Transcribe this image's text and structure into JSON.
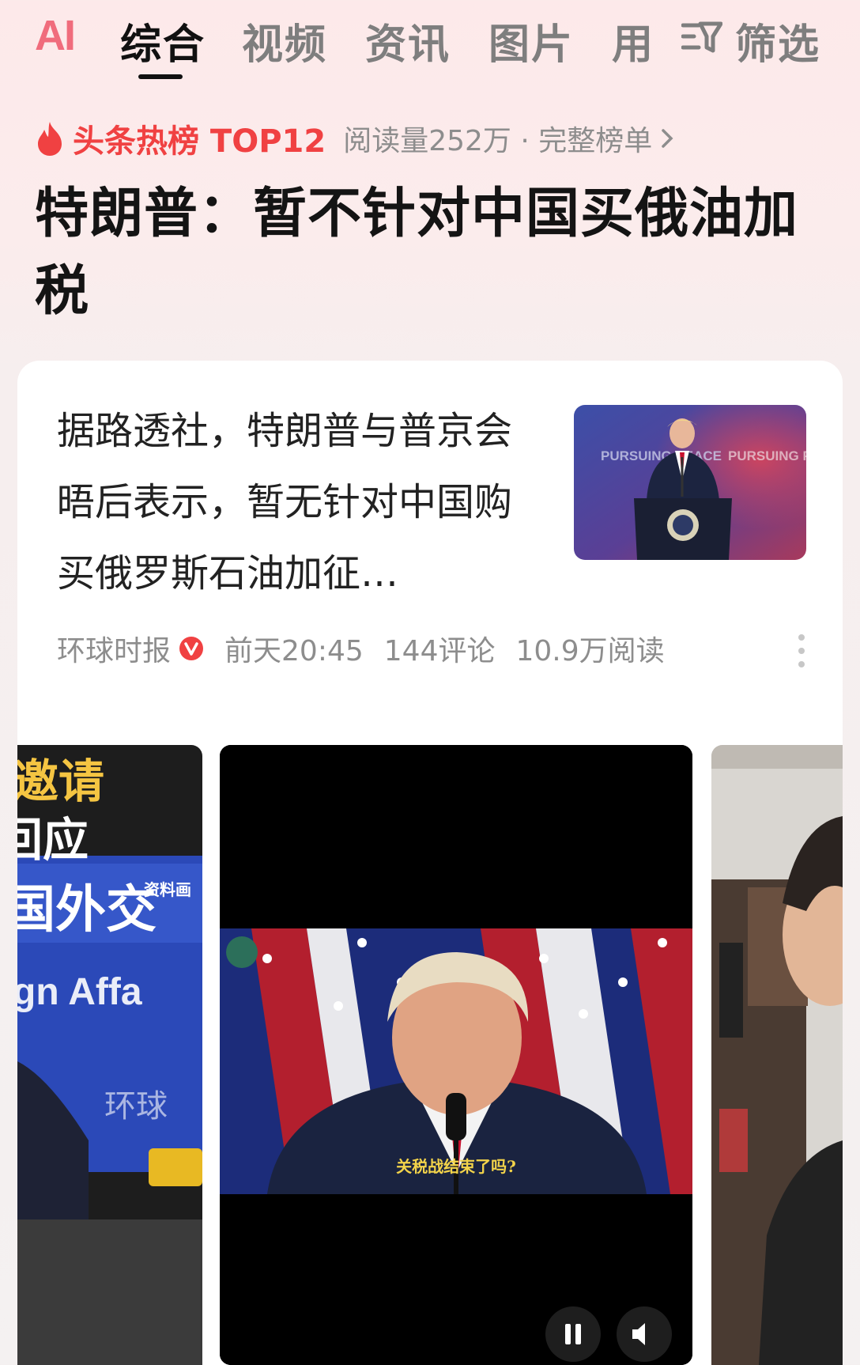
{
  "tabs": {
    "ai": "AI",
    "items": [
      "综合",
      "视频",
      "资讯",
      "图片",
      "用"
    ],
    "active": "综合",
    "filter_label": "筛选"
  },
  "hot": {
    "label": "头条热榜 TOP12",
    "meta": "阅读量252万 · 完整榜单",
    "headline": "特朗普：暂不针对中国买俄油加税"
  },
  "card": {
    "summary": "据路透社，特朗普与普京会晤后表示，暂无针对中国购买俄罗斯石油加征…",
    "source": "环球时报",
    "time": "前天20:45",
    "comments": "144评论",
    "reads": "10.9万阅读",
    "thumb_text": "PURSUING PEACE"
  },
  "videos": {
    "left_overlay": [
      "邀请",
      "回应",
      "国外交",
      "gn Affa",
      "环球",
      "资料画"
    ],
    "center_caption": "关税战结束了吗?"
  },
  "colors": {
    "accent": "#f04142",
    "ai": "#f06c7c",
    "muted": "#8d8d8d"
  }
}
